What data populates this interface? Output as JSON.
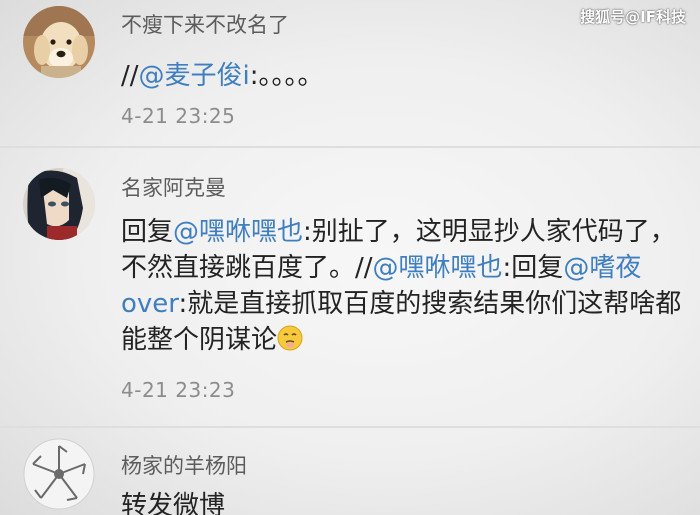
{
  "watermark": "搜狐号@IF科技",
  "comments": [
    {
      "username": "不瘦下来不改名了",
      "segments": [
        {
          "text": "//",
          "mention": false
        },
        {
          "text": "@麦子俊i",
          "mention": true
        },
        {
          "text": ":。。。。",
          "mention": false
        }
      ],
      "timestamp": "4-21 23:25",
      "avatar_icon": "dog-photo-avatar"
    },
    {
      "username": "名家阿克曼",
      "segments": [
        {
          "text": "回复",
          "mention": false
        },
        {
          "text": "@嘿咻嘿也",
          "mention": true
        },
        {
          "text": ":别扯了，这明显抄人家代码了，不然直接跳百度了。//",
          "mention": false
        },
        {
          "text": "@嘿咻嘿也",
          "mention": true
        },
        {
          "text": ":回复",
          "mention": false
        },
        {
          "text": "@嗜夜over",
          "mention": true
        },
        {
          "text": ":就是直接抓取百度的搜索结果你们这帮啥都能整个阴谋论",
          "mention": false
        }
      ],
      "emoji": "smirk-emoji",
      "timestamp": "4-21 23:23",
      "avatar_icon": "anime-character-avatar"
    },
    {
      "username": "杨家的羊杨阳",
      "segments": [
        {
          "text": "转发微博",
          "mention": false
        }
      ],
      "timestamp": "",
      "avatar_icon": "logo-avatar"
    }
  ],
  "colors": {
    "mention": "#3f7fbf",
    "body_text": "#232323",
    "username": "#5c5c5c",
    "timestamp": "#8c8c8c"
  }
}
